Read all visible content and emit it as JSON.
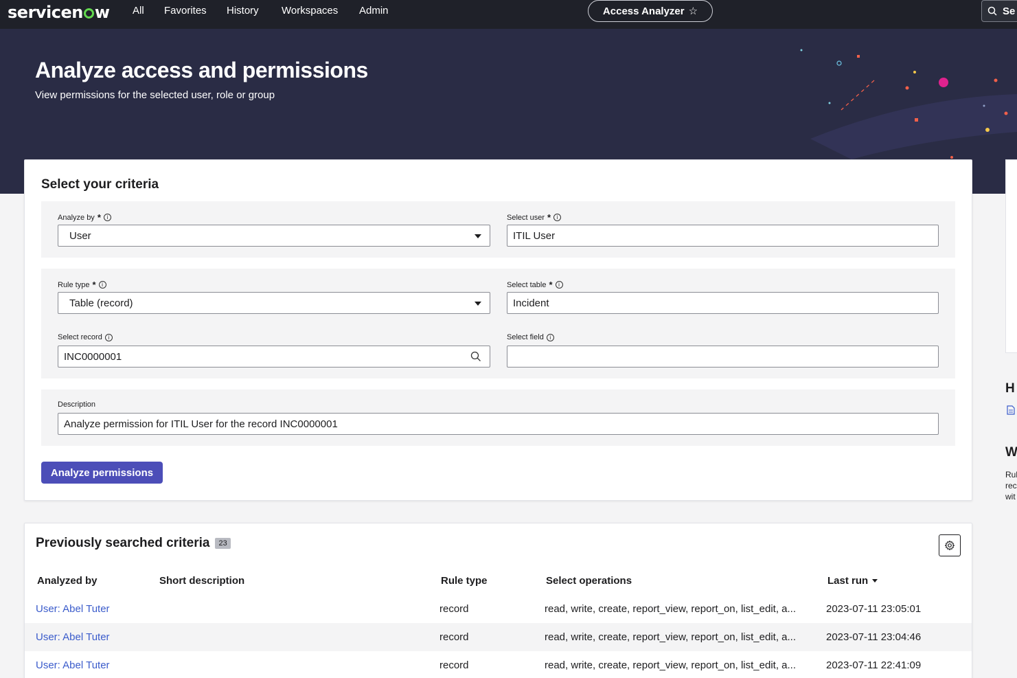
{
  "nav": {
    "brand": "servicenow",
    "items": [
      "All",
      "Favorites",
      "History",
      "Workspaces",
      "Admin"
    ],
    "app_pill": "Access Analyzer",
    "search_label": "Se"
  },
  "hero": {
    "title": "Analyze access and permissions",
    "subtitle": "View permissions for the selected user, role or group"
  },
  "criteria": {
    "title": "Select your criteria",
    "analyze_by": {
      "label": "Analyze by",
      "value": "User"
    },
    "select_user": {
      "label": "Select user",
      "value": "ITIL User"
    },
    "rule_type": {
      "label": "Rule type",
      "value": "Table (record)"
    },
    "select_table": {
      "label": "Select table",
      "value": "Incident"
    },
    "select_record": {
      "label": "Select record",
      "value": "INC0000001"
    },
    "select_field": {
      "label": "Select field",
      "value": ""
    },
    "description": {
      "label": "Description",
      "value": "Analyze permission for ITIL User for the record INC0000001"
    },
    "analyze_button": "Analyze permissions"
  },
  "previous": {
    "title": "Previously searched criteria",
    "count": "23",
    "columns": [
      "Analyzed by",
      "Short description",
      "Rule type",
      "Select operations",
      "Last run"
    ],
    "rows": [
      {
        "analyzed_by": "User: Abel Tuter",
        "short_description": "",
        "rule_type": "record",
        "operations": "read, write, create, report_view, report_on, list_edit, a...",
        "last_run": "2023-07-11 23:05:01"
      },
      {
        "analyzed_by": "User: Abel Tuter",
        "short_description": "",
        "rule_type": "record",
        "operations": "read, write, create, report_view, report_on, list_edit, a...",
        "last_run": "2023-07-11 23:04:46"
      },
      {
        "analyzed_by": "User: Abel Tuter",
        "short_description": "",
        "rule_type": "record",
        "operations": "read, write, create, report_view, report_on, list_edit, a...",
        "last_run": "2023-07-11 22:41:09"
      }
    ]
  },
  "side": {
    "heading1": "H",
    "heading2": "W",
    "lines": [
      "Rul",
      "rec",
      "wit"
    ]
  },
  "colors": {
    "nav_bg": "#1f2129",
    "hero_bg": "#2a2c45",
    "primary": "#4c4eb8",
    "link": "#3a5bcb"
  }
}
